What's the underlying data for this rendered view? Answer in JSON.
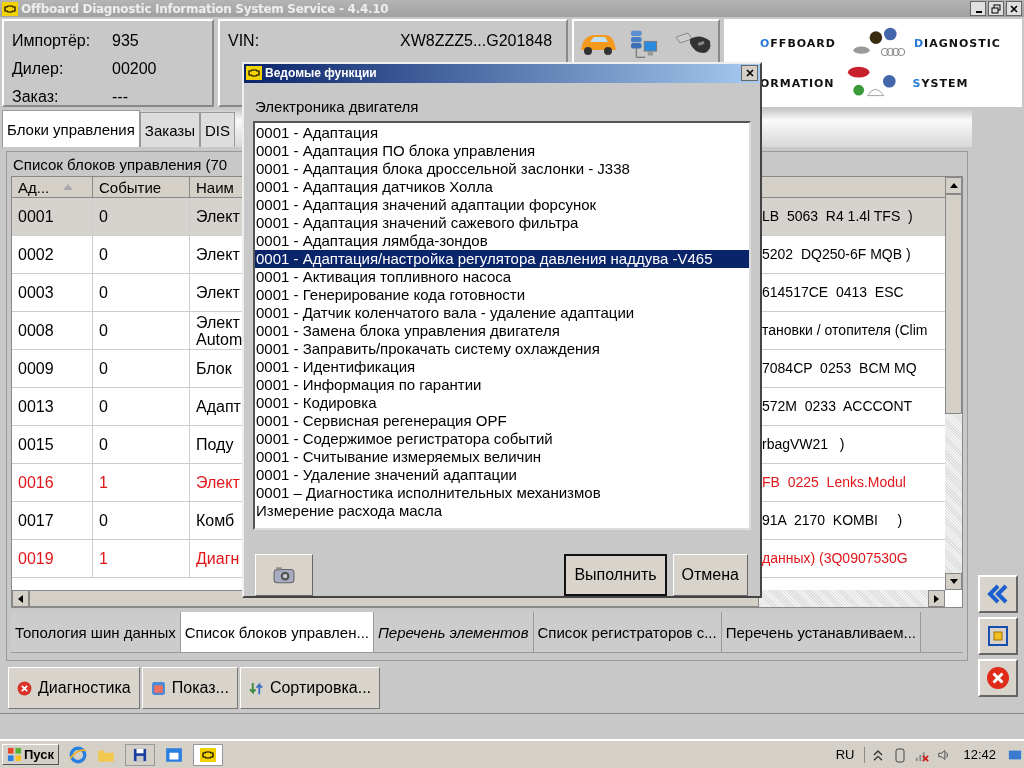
{
  "window": {
    "title": "Offboard Diagnostic Information System Service - 4.4.10"
  },
  "info": [
    {
      "label": "Импортёр:",
      "value": "935"
    },
    {
      "label": "Дилер:",
      "value": "00200"
    },
    {
      "label": "Заказ:",
      "value": "---"
    }
  ],
  "vehicle": {
    "label": "VIN:",
    "value": "XW8ZZZ5...G201848"
  },
  "logo": [
    {
      "text": "OFFBOARD",
      "accent_first": true
    },
    {
      "text": "DIAGNOSTIC",
      "accent_first": true
    },
    {
      "text": "ORMATION",
      "accent_first": false
    },
    {
      "text": "SYSTEM",
      "accent_first": true
    }
  ],
  "tabs": [
    {
      "label": "Блоки управления",
      "selected": true
    },
    {
      "label": "Заказы",
      "selected": false
    },
    {
      "label": "DIS",
      "selected": false
    }
  ],
  "list_title": "Список блоков управления (70",
  "table": {
    "columns": [
      {
        "label": "Ад...",
        "sorted": true
      },
      {
        "label": "Событие",
        "sorted": false
      },
      {
        "label": "Наим",
        "sorted": false
      }
    ],
    "rows": [
      {
        "address": "0001",
        "event": "0",
        "name": [
          "Элект"
        ],
        "tail": "LB  5063  R4 1.4l TFS  )",
        "selected": true,
        "error": false
      },
      {
        "address": "0002",
        "event": "0",
        "name": [
          "Элект"
        ],
        "tail": "5202  DQ250-6F MQB )",
        "selected": false,
        "error": false
      },
      {
        "address": "0003",
        "event": "0",
        "name": [
          "Элект"
        ],
        "tail": "614517CE  0413  ESC",
        "selected": false,
        "error": false
      },
      {
        "address": "0008",
        "event": "0",
        "name": [
          "Элект",
          "Autom"
        ],
        "tail": "тановки / отопителя (Clim",
        "selected": false,
        "error": false
      },
      {
        "address": "0009",
        "event": "0",
        "name": [
          "Блок"
        ],
        "tail": "7084CP  0253  BCM MQ",
        "selected": false,
        "error": false
      },
      {
        "address": "0013",
        "event": "0",
        "name": [
          "Адапт"
        ],
        "tail": "572M  0233  ACCCONT",
        "selected": false,
        "error": false
      },
      {
        "address": "0015",
        "event": "0",
        "name": [
          "Поду"
        ],
        "tail": "rbagVW21   )",
        "selected": false,
        "error": false
      },
      {
        "address": "0016",
        "event": "1",
        "name": [
          "Элект"
        ],
        "tail": "FB  0225  Lenks.Modul",
        "selected": false,
        "error": true
      },
      {
        "address": "0017",
        "event": "0",
        "name": [
          "Комб"
        ],
        "tail": "91A  2170  KOMBI     )",
        "selected": false,
        "error": false
      },
      {
        "address": "0019",
        "event": "1",
        "name": [
          "Диагн"
        ],
        "tail": "данных) (3Q0907530G",
        "selected": false,
        "error": true
      }
    ]
  },
  "bottom_tabs": [
    {
      "label": "Топология шин данных",
      "selected": false,
      "italic": false
    },
    {
      "label": "Список блоков управлен...",
      "selected": true,
      "italic": false
    },
    {
      "label": "Перечень элементов",
      "selected": false,
      "italic": true
    },
    {
      "label": "Список регистраторов с...",
      "selected": false,
      "italic": false
    },
    {
      "label": "Перечень устанавливаем...",
      "selected": false,
      "italic": false
    }
  ],
  "actions": [
    {
      "label": "Диагностика"
    },
    {
      "label": "Показ..."
    },
    {
      "label": "Сортировка..."
    }
  ],
  "dialog": {
    "title": "Ведомые функции",
    "subtitle": "Электроника двигателя",
    "items": [
      {
        "label": "0001 - Адаптация",
        "selected": false
      },
      {
        "label": "0001 - Адаптация ПО блока управления",
        "selected": false
      },
      {
        "label": "0001 - Адаптация блока дроссельной заслонки - J338",
        "selected": false
      },
      {
        "label": "0001 - Адаптация датчиков Холла",
        "selected": false
      },
      {
        "label": "0001 - Адаптация значений адаптации форсунок",
        "selected": false
      },
      {
        "label": "0001 - Адаптация значений сажевого фильтра",
        "selected": false
      },
      {
        "label": "0001 - Адаптация лямбда-зондов",
        "selected": false
      },
      {
        "label": "0001 - Адаптация/настройка регулятора давления наддува -V465",
        "selected": true
      },
      {
        "label": "0001 - Активация топливного насоса",
        "selected": false
      },
      {
        "label": "0001 - Генерирование кода готовности",
        "selected": false
      },
      {
        "label": "0001 - Датчик коленчатого вала - удаление адаптации",
        "selected": false
      },
      {
        "label": "0001 - Замена блока управления двигателя",
        "selected": false
      },
      {
        "label": "0001 - Заправить/прокачать систему охлаждения",
        "selected": false
      },
      {
        "label": "0001 - Идентификация",
        "selected": false
      },
      {
        "label": "0001 - Информация по гарантии",
        "selected": false
      },
      {
        "label": "0001 - Кодировка",
        "selected": false
      },
      {
        "label": "0001 - Сервисная регенерация OPF",
        "selected": false
      },
      {
        "label": "0001 - Содержимое регистратора событий",
        "selected": false
      },
      {
        "label": "0001 - Считывание измеряемых величин",
        "selected": false
      },
      {
        "label": "0001 - Удаление значений адаптации",
        "selected": false
      },
      {
        "label": "0001 – Диагностика исполнительных механизмов",
        "selected": false
      },
      {
        "label": "Измерение расхода масла",
        "selected": false
      }
    ],
    "buttons": [
      {
        "label": "Выполнить",
        "default": true
      },
      {
        "label": "Отмена",
        "default": false
      }
    ]
  },
  "taskbar": {
    "start": "Пуск",
    "language": "RU",
    "clock": "12:42"
  }
}
